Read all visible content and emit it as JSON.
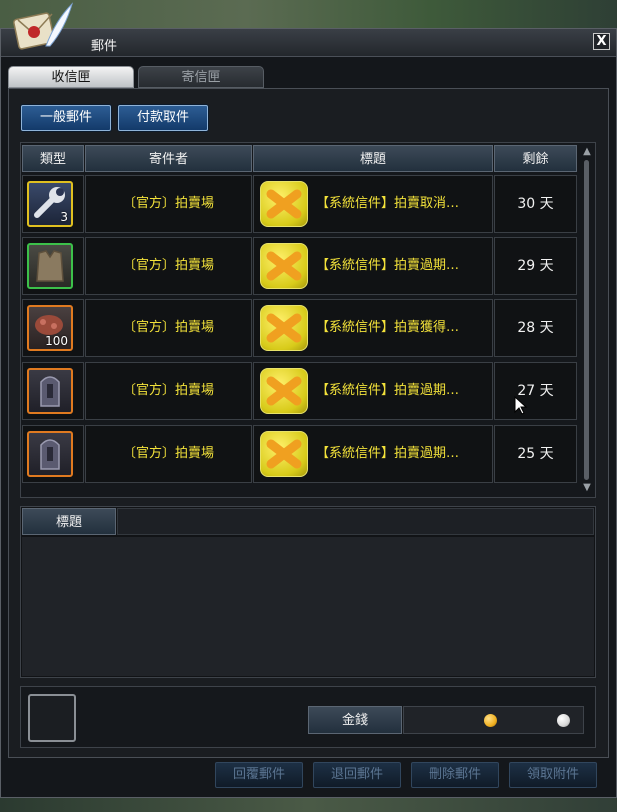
{
  "window": {
    "title": "郵件",
    "close_label": "X"
  },
  "tabs": [
    {
      "label": "收信匣",
      "active": true
    },
    {
      "label": "寄信匣",
      "active": false
    }
  ],
  "filters": {
    "general_label": "一般郵件",
    "cod_label": "付款取件"
  },
  "table": {
    "headers": {
      "type": "類型",
      "sender": "寄件者",
      "subject": "標題",
      "remaining": "剩餘"
    },
    "rows": [
      {
        "item_icon": "wrench-icon",
        "item_count": "3",
        "item_border": "#e0c020",
        "sender": "〔官方〕拍賣場",
        "subject": "【系統信件】拍賣取消…",
        "remaining": "30 天"
      },
      {
        "item_icon": "armor-vest-icon",
        "item_count": "",
        "item_border": "#3cc04a",
        "sender": "〔官方〕拍賣場",
        "subject": "【系統信件】拍賣過期…",
        "remaining": "29 天"
      },
      {
        "item_icon": "ore-icon",
        "item_count": "100",
        "item_border": "#e07a20",
        "sender": "〔官方〕拍賣場",
        "subject": "【系統信件】拍賣獲得…",
        "remaining": "28 天"
      },
      {
        "item_icon": "tombstone-icon",
        "item_count": "",
        "item_border": "#e07a20",
        "sender": "〔官方〕拍賣場",
        "subject": "【系統信件】拍賣過期…",
        "remaining": "27 天"
      },
      {
        "item_icon": "tombstone-icon",
        "item_count": "",
        "item_border": "#e07a20",
        "sender": "〔官方〕拍賣場",
        "subject": "【系統信件】拍賣過期…",
        "remaining": "25 天"
      }
    ]
  },
  "detail": {
    "subject_label": "標題",
    "subject_value": ""
  },
  "attachment": {
    "money_label": "金錢",
    "gold_coin_color": "#f0b020",
    "silver_coin_color": "#d8d8d8"
  },
  "actions": {
    "reply": "回覆郵件",
    "return": "退回郵件",
    "delete": "刪除郵件",
    "take": "領取附件"
  }
}
